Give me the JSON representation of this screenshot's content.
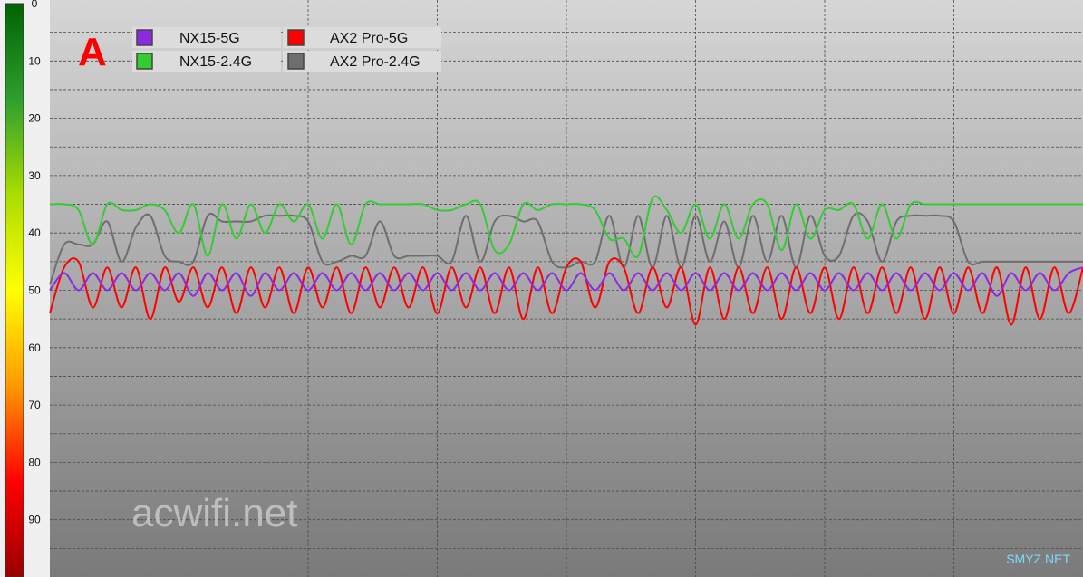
{
  "chart_data": {
    "type": "line",
    "panel_label": "A",
    "watermark": "acwifi.net",
    "corner_watermark": "SMYZ.NET",
    "y_axis": {
      "range": [
        0,
        100
      ],
      "inverted": true,
      "ticks": [
        0,
        10,
        20,
        30,
        40,
        50,
        60,
        70,
        80,
        90
      ],
      "tick_labels": [
        "0",
        "10",
        "20",
        "30",
        "40",
        "50",
        "60",
        "70",
        "80",
        "90"
      ],
      "color_scale": [
        "#006400",
        "#2e9e2e",
        "#aadd00",
        "#ffff00",
        "#ff9900",
        "#ff0000",
        "#990000"
      ]
    },
    "grid": true,
    "background_gradient": [
      "#d6d6d6",
      "#7a7a7a"
    ],
    "legend": {
      "placement": "top-left",
      "columns": 2
    },
    "x": [
      0,
      0.5,
      1,
      1.5,
      2,
      2.5,
      3,
      3.5,
      4,
      4.5,
      5,
      5.5,
      6,
      6.5,
      7,
      7.5,
      8,
      8.5,
      9,
      9.5,
      10,
      10.5,
      11,
      11.5,
      12,
      12.5,
      13,
      13.5,
      14,
      14.5,
      15,
      15.5,
      16,
      16.5,
      17,
      17.5,
      18,
      18.5,
      19,
      19.5,
      20,
      20.5,
      21,
      21.5,
      22,
      22.5,
      23,
      23.5,
      24,
      24.5,
      25,
      25.5,
      26,
      26.5,
      27,
      27.5,
      28,
      28.5,
      29,
      29.5,
      30,
      30.5,
      31,
      31.5,
      32,
      32.5,
      33,
      33.5,
      34,
      34.5,
      35,
      35.5,
      36
    ],
    "series": [
      {
        "name": "NX15-5G",
        "color": "#8a2be2",
        "values": [
          50,
          47,
          50,
          47,
          50,
          47,
          50,
          47,
          50,
          47,
          51,
          47,
          50,
          47,
          51,
          47,
          50,
          47,
          50,
          47,
          50,
          47,
          50,
          47,
          50,
          47,
          50,
          47,
          50,
          47,
          50,
          47,
          50,
          47,
          50,
          47,
          50,
          47,
          50,
          47,
          50,
          47,
          50,
          47,
          50,
          47,
          50,
          47,
          50,
          47,
          50,
          47,
          50,
          47,
          50,
          47,
          50,
          47,
          50,
          47,
          50,
          47,
          50,
          47,
          50,
          47,
          51,
          47,
          50,
          47,
          50,
          47,
          46
        ]
      },
      {
        "name": "NX15-2.4G",
        "color": "#33cc33",
        "values": [
          35,
          35,
          36,
          42,
          35,
          36,
          36,
          35,
          36,
          40,
          35,
          44,
          35,
          41,
          35,
          40,
          35,
          38,
          35,
          41,
          35,
          42,
          35,
          35,
          35,
          35,
          35,
          36,
          36,
          35,
          35,
          43,
          42,
          35,
          36,
          35,
          35,
          35,
          36,
          41,
          41,
          44,
          34,
          36,
          40,
          35,
          41,
          35,
          41,
          35,
          35,
          43,
          35,
          41,
          36,
          36,
          35,
          41,
          35,
          41,
          35,
          35,
          35,
          35,
          35,
          35,
          35,
          35,
          35,
          35,
          35,
          35,
          35
        ]
      },
      {
        "name": "AX2 Pro-5G",
        "color": "#ff0000",
        "values": [
          54,
          46,
          45,
          53,
          46,
          53,
          46,
          55,
          46,
          52,
          46,
          53,
          46,
          54,
          46,
          53,
          46,
          54,
          46,
          53,
          46,
          54,
          46,
          53,
          46,
          53,
          46,
          54,
          46,
          53,
          46,
          54,
          46,
          55,
          46,
          54,
          46,
          45,
          53,
          45,
          46,
          54,
          46,
          53,
          46,
          56,
          46,
          55,
          46,
          54,
          46,
          55,
          46,
          54,
          46,
          55,
          46,
          54,
          46,
          54,
          46,
          55,
          46,
          54,
          46,
          54,
          46,
          56,
          46,
          55,
          46,
          54,
          46
        ]
      },
      {
        "name": "AX2 Pro-2.4G",
        "color": "#6e6e6e",
        "values": [
          49,
          42,
          42,
          42,
          38,
          45,
          39,
          37,
          44,
          45,
          45,
          37,
          38,
          38,
          38,
          37,
          37,
          37,
          38,
          45,
          45,
          44,
          44,
          38,
          44,
          44,
          44,
          44,
          45,
          37,
          45,
          38,
          37,
          38,
          38,
          45,
          46,
          45,
          45,
          37,
          46,
          37,
          46,
          37,
          46,
          37,
          45,
          38,
          46,
          37,
          45,
          37,
          46,
          37,
          44,
          44,
          37,
          38,
          45,
          38,
          37,
          37,
          37,
          38,
          45,
          45,
          45,
          45,
          45,
          45,
          45,
          45,
          45
        ]
      }
    ]
  }
}
